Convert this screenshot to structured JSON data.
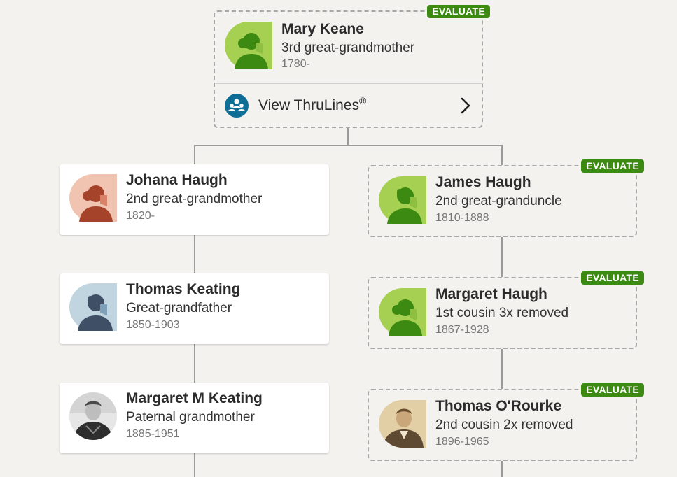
{
  "focus": {
    "name": "Mary Keane",
    "relation": "3rd great-grandmother",
    "dates": "1780-",
    "badge": "EVALUATE",
    "avatar": "female-silhouette-icon",
    "thrulines_label": "View ThruLines",
    "thrulines_mark": "®",
    "thrulines_icon": "people-group-icon"
  },
  "left_branch": [
    {
      "name": "Johana Haugh",
      "relation": "2nd great-grandmother",
      "dates": "1820-",
      "avatar": "female-silhouette-icon"
    },
    {
      "name": "Thomas Keating",
      "relation": "Great-grandfather",
      "dates": "1850-1903",
      "avatar": "male-silhouette-icon"
    },
    {
      "name": "Margaret M Keating",
      "relation": "Paternal grandmother",
      "dates": "1885-1951",
      "avatar": "photo-portrait"
    }
  ],
  "right_branch": [
    {
      "name": "James Haugh",
      "relation": "2nd great-granduncle",
      "dates": "1810-1888",
      "badge": "EVALUATE",
      "avatar": "male-silhouette-icon"
    },
    {
      "name": "Margaret Haugh",
      "relation": "1st cousin 3x removed",
      "dates": "1867-1928",
      "badge": "EVALUATE",
      "avatar": "female-silhouette-icon"
    },
    {
      "name": "Thomas O'Rourke",
      "relation": "2nd cousin 2x removed",
      "dates": "1896-1965",
      "badge": "EVALUATE",
      "avatar": "photo-portrait"
    }
  ],
  "colors": {
    "evaluate_badge": "#3c8a12",
    "green_avatar_bg": "#a6d052",
    "green_avatar_fg": "#3c8a12",
    "female_avatar_bg": "#f0c4b1",
    "female_avatar_fg": "#a4432a",
    "male_avatar_bg": "#c0d5e0",
    "male_avatar_fg": "#3e4f66",
    "thrulines_icon": "#0e6e96"
  }
}
